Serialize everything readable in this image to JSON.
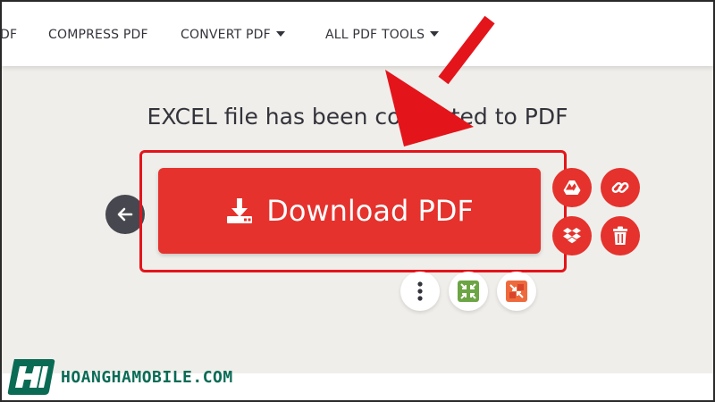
{
  "nav": {
    "items": [
      {
        "label": "DF"
      },
      {
        "label": "COMPRESS PDF"
      },
      {
        "label": "CONVERT PDF"
      },
      {
        "label": "ALL PDF TOOLS"
      }
    ]
  },
  "main": {
    "status_title": "EXCEL file has been converted to PDF",
    "download_label": "Download PDF"
  },
  "icons": {
    "back": "arrow-left-icon",
    "download": "download-icon",
    "google_drive": "google-drive-icon",
    "link": "link-icon",
    "dropbox": "dropbox-icon",
    "delete": "trash-icon",
    "more": "more-vertical-icon",
    "compress": "compress-icon",
    "split": "split-icon"
  },
  "colors": {
    "accent": "#e5322d",
    "highlight": "#e4141b",
    "background": "#f0eeea",
    "text": "#33333b",
    "logo": "#0a6b55"
  },
  "footer": {
    "logo_text": "HOANGHAMOBILE.COM"
  }
}
